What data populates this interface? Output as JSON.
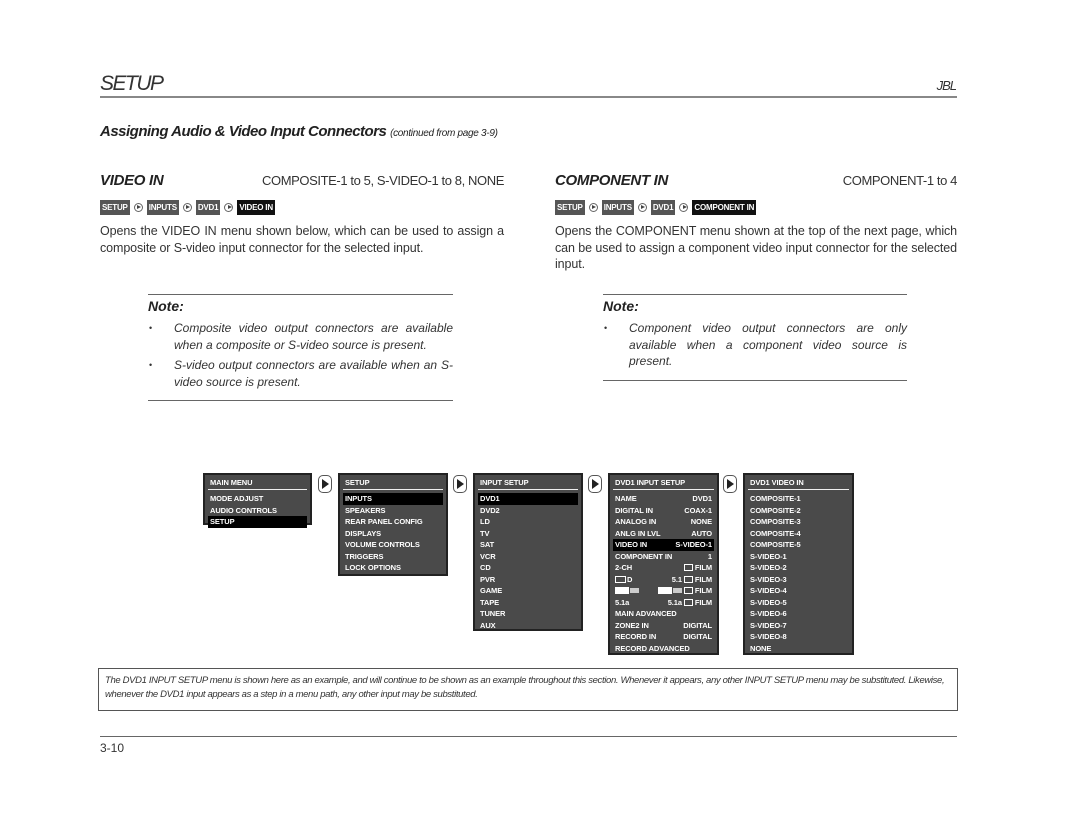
{
  "header": {
    "title": "SETUP",
    "logo": "JBL"
  },
  "section": {
    "title": "Assigning Audio & Video Input Connectors",
    "continued": "(continued from page 3-9)"
  },
  "video_in": {
    "name": "VIDEO IN",
    "range": "COMPOSITE-1 to 5, S-VIDEO-1 to 8, NONE",
    "path": [
      "SETUP",
      "INPUTS",
      "DVD1",
      "VIDEO IN"
    ],
    "description": "Opens the VIDEO IN menu shown below, which can be used to assign a composite or S-video input connector for the selected input.",
    "note": {
      "title": "Note:",
      "items": [
        "Composite video output connectors are available when a composite or S-video source is present.",
        "S-video output connectors are available when an S-video source is present."
      ]
    }
  },
  "component_in": {
    "name": "COMPONENT IN",
    "range": "COMPONENT-1 to 4",
    "path": [
      "SETUP",
      "INPUTS",
      "DVD1",
      "COMPONENT IN"
    ],
    "description": "Opens the COMPONENT menu shown at the top of the next page, which can be used to assign a component video input connector for the selected input.",
    "note": {
      "title": "Note:",
      "items": [
        "Component video output connectors are only available when a component video source is present."
      ]
    }
  },
  "menus": {
    "main": {
      "title": "MAIN MENU",
      "items": [
        "MODE ADJUST",
        "AUDIO CONTROLS",
        "SETUP"
      ],
      "selected": "SETUP"
    },
    "setup": {
      "title": "SETUP",
      "items": [
        "INPUTS",
        "SPEAKERS",
        "REAR PANEL CONFIG",
        "DISPLAYS",
        "VOLUME CONTROLS",
        "TRIGGERS",
        "LOCK OPTIONS"
      ],
      "selected": "INPUTS"
    },
    "input_setup": {
      "title": "INPUT SETUP",
      "items": [
        "DVD1",
        "DVD2",
        "LD",
        "TV",
        "SAT",
        "VCR",
        "CD",
        "PVR",
        "GAME",
        "TAPE",
        "TUNER",
        "AUX"
      ],
      "selected": "DVD1"
    },
    "dvd1_input_setup": {
      "title": "DVD1 INPUT SETUP",
      "items": [
        {
          "label": "NAME",
          "value": "DVD1"
        },
        {
          "label": "DIGITAL IN",
          "value": "COAX-1"
        },
        {
          "label": "ANALOG IN",
          "value": "NONE"
        },
        {
          "label": "ANLG IN LVL",
          "value": "AUTO"
        },
        {
          "label": "VIDEO IN",
          "value": "S-VIDEO-1"
        },
        {
          "label": "COMPONENT IN",
          "value": "1"
        },
        {
          "label": "2-CH",
          "value": "FILM"
        },
        {
          "label": "D",
          "mid": "5.1",
          "value": "FILM"
        },
        {
          "label": "",
          "mid": "",
          "value": "FILM"
        },
        {
          "label": "5.1a",
          "mid": "5.1a",
          "value": "FILM"
        },
        {
          "label": "MAIN ADVANCED",
          "value": ""
        },
        {
          "label": "ZONE2 IN",
          "value": "DIGITAL"
        },
        {
          "label": "RECORD IN",
          "value": "DIGITAL"
        },
        {
          "label": "RECORD ADVANCED",
          "value": ""
        }
      ],
      "selected": "VIDEO IN"
    },
    "dvd1_video_in": {
      "title": "DVD1 VIDEO IN",
      "items": [
        "COMPOSITE-1",
        "COMPOSITE-2",
        "COMPOSITE-3",
        "COMPOSITE-4",
        "COMPOSITE-5",
        "S-VIDEO-1",
        "S-VIDEO-2",
        "S-VIDEO-3",
        "S-VIDEO-4",
        "S-VIDEO-5",
        "S-VIDEO-6",
        "S-VIDEO-7",
        "S-VIDEO-8",
        "NONE"
      ]
    }
  },
  "caption": "The DVD1 INPUT SETUP menu is shown here as an example, and will continue to be shown as an example throughout this section. Whenever it appears, any other INPUT SETUP menu may be substituted. Likewise, whenever the DVD1 input appears as a step in a menu path, any other input may be substituted.",
  "footer": {
    "page_number": "3-10"
  }
}
